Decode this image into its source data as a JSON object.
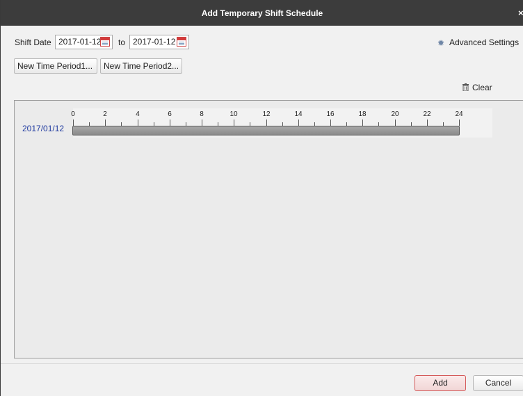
{
  "dialog": {
    "title": "Add Temporary Shift Schedule",
    "close_label": "×"
  },
  "shift_date": {
    "label": "Shift Date",
    "start": "2017-01-12",
    "to_label": "to",
    "end": "2017-01-12",
    "calendar_icon": "calendar-icon"
  },
  "advanced_settings": {
    "icon": "gear-icon",
    "label": "Advanced Settings"
  },
  "time_periods": [
    {
      "label": "New Time Period1..."
    },
    {
      "label": "New Time Period2..."
    }
  ],
  "clear": {
    "icon": "trash-icon",
    "label": "Clear"
  },
  "schedule": {
    "rows": [
      {
        "date": "2017/01/12"
      }
    ],
    "hour_labels": [
      "0",
      "2",
      "4",
      "6",
      "8",
      "10",
      "12",
      "14",
      "16",
      "18",
      "20",
      "22",
      "24"
    ]
  },
  "footer": {
    "add_label": "Add",
    "cancel_label": "Cancel"
  },
  "colors": {
    "title_bar": "#3c3c3c",
    "date_text": "#1f3aa0",
    "add_button_border": "#d45a5a"
  }
}
